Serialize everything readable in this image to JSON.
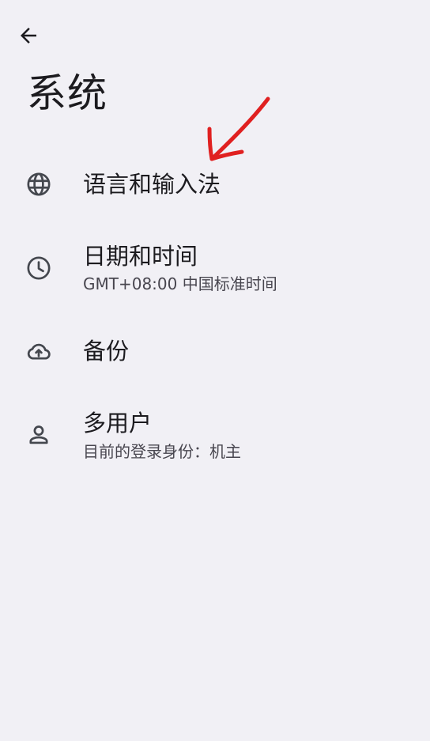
{
  "header": {
    "back_icon": "arrow-back-icon",
    "title": "系统"
  },
  "annotation": {
    "color": "#e02020",
    "icon": "red-arrow-annotation"
  },
  "items": [
    {
      "icon": "globe-icon",
      "title": "语言和输入法",
      "summary": ""
    },
    {
      "icon": "clock-icon",
      "title": "日期和时间",
      "summary": "GMT+08:00 中国标准时间"
    },
    {
      "icon": "cloud-upload-icon",
      "title": "备份",
      "summary": ""
    },
    {
      "icon": "person-icon",
      "title": "多用户",
      "summary": "目前的登录身份：机主"
    }
  ],
  "colors": {
    "background": "#f1f0f5",
    "text_primary": "#1c1b1f",
    "text_secondary": "#48464f"
  }
}
